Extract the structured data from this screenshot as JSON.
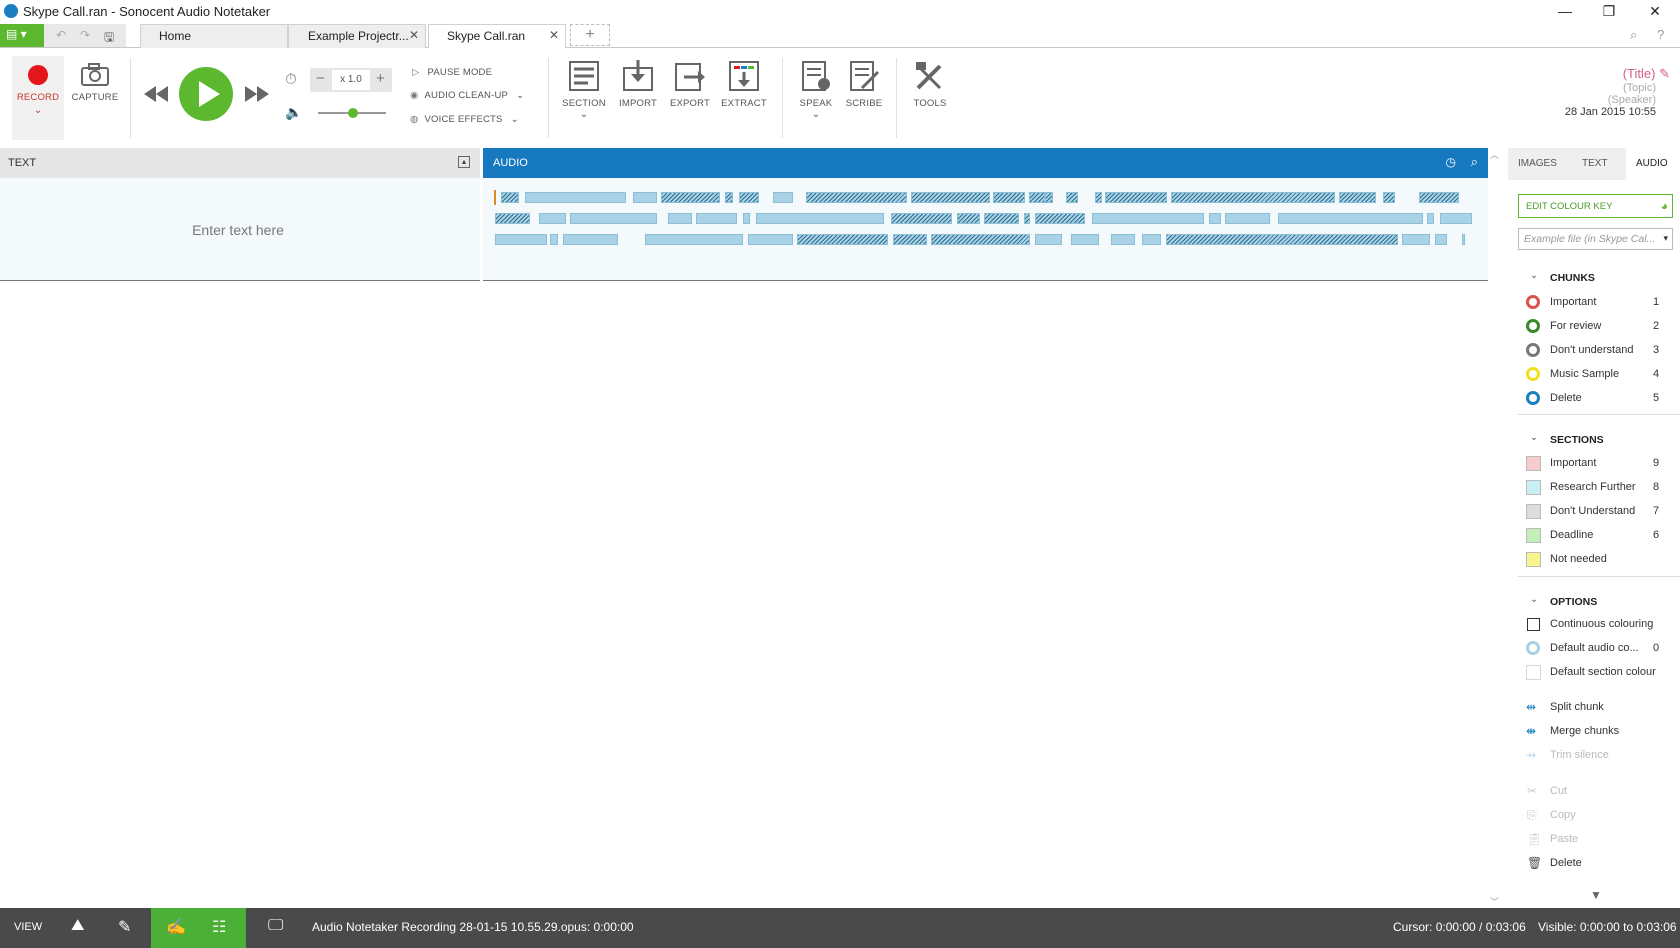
{
  "window": {
    "title": "Skype Call.ran - Sonocent Audio Notetaker",
    "minimize": "—",
    "restore": "❐",
    "close": "✕"
  },
  "tabs": [
    {
      "label": "Home"
    },
    {
      "label": "Example Projectr..."
    },
    {
      "label": "Skype Call.ran"
    }
  ],
  "new_tab": "+",
  "ribbon": {
    "record": "RECORD",
    "capture": "CAPTURE",
    "speed": "x 1.0",
    "pause_mode": "PAUSE MODE",
    "audio_cleanup": "AUDIO CLEAN-UP",
    "voice_effects": "VOICE EFFECTS",
    "section": "SECTION",
    "import": "IMPORT",
    "export": "EXPORT",
    "extract": "EXTRACT",
    "speak": "SPEAK",
    "scribe": "SCRIBE",
    "tools": "TOOLS"
  },
  "meta": {
    "title": "(Title)",
    "topic": "(Topic)",
    "speaker": "(Speaker)",
    "date": "28 Jan 2015 10:55"
  },
  "text_panel": {
    "header": "TEXT",
    "placeholder": "Enter text here"
  },
  "audio_panel": {
    "header": "AUDIO"
  },
  "sidebar": {
    "tabs": [
      "IMAGES",
      "TEXT",
      "AUDIO"
    ],
    "edit_colour_key": "EDIT COLOUR KEY",
    "file_combo": "Example file (in Skype Cal...",
    "chunks_header": "CHUNKS",
    "chunks": [
      {
        "label": "Important",
        "num": "1",
        "color": "#d9534f"
      },
      {
        "label": "For review",
        "num": "2",
        "color": "#3a8a2a"
      },
      {
        "label": "Don't understand",
        "num": "3",
        "color": "#777777"
      },
      {
        "label": "Music Sample",
        "num": "4",
        "color": "#f0e020"
      },
      {
        "label": "Delete",
        "num": "5",
        "color": "#1a7fc1"
      }
    ],
    "sections_header": "SECTIONS",
    "sections": [
      {
        "label": "Important",
        "num": "9",
        "color": "#f8cccc"
      },
      {
        "label": "Research Further",
        "num": "8",
        "color": "#c8f0f4"
      },
      {
        "label": "Don't Understand",
        "num": "7",
        "color": "#dddddd"
      },
      {
        "label": "Deadline",
        "num": "6",
        "color": "#c4f0b8"
      },
      {
        "label": "Not needed",
        "num": "",
        "color": "#f8f490"
      }
    ],
    "options_header": "OPTIONS",
    "options": [
      {
        "label": "Continuous colouring",
        "num": ""
      },
      {
        "label": "Default audio co...",
        "num": "0"
      },
      {
        "label": "Default section colour",
        "num": ""
      }
    ],
    "actions": [
      {
        "label": "Split chunk",
        "enabled": true
      },
      {
        "label": "Merge chunks",
        "enabled": true
      },
      {
        "label": "Trim silence",
        "enabled": false
      }
    ],
    "edit_actions": [
      {
        "label": "Cut",
        "enabled": false
      },
      {
        "label": "Copy",
        "enabled": false
      },
      {
        "label": "Paste",
        "enabled": false
      },
      {
        "label": "Delete",
        "enabled": true
      }
    ]
  },
  "statusbar": {
    "view": "VIEW",
    "recording": "Audio Notetaker Recording 28-01-15 10.55.29.opus: 0:00:00",
    "cursor_label": "Cursor:",
    "cursor": "0:00:00 / 0:03:06",
    "visible_label": "Visible:",
    "visible": "0:00:00 to 0:03:06"
  }
}
